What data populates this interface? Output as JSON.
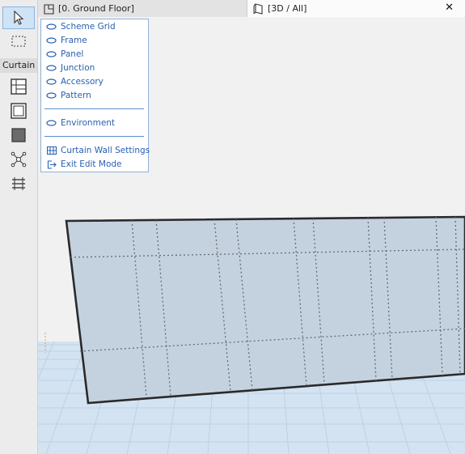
{
  "toolbox": {
    "section_label": "Curtain Wall",
    "tools": [
      {
        "icon": "arrow-pointer-icon"
      },
      {
        "icon": "marquee-icon"
      },
      {
        "icon": "curtain-wall-icon"
      },
      {
        "icon": "frame-icon"
      },
      {
        "icon": "panel-icon"
      },
      {
        "icon": "junction-icon"
      },
      {
        "icon": "accessory-icon"
      }
    ]
  },
  "tabs": [
    {
      "label": "[0. Ground Floor]",
      "icon": "floor-plan-icon"
    },
    {
      "label": "[3D / All]",
      "icon": "3d-view-icon"
    }
  ],
  "tab_close": "✕",
  "menu": {
    "visibility_items": [
      {
        "label": "Scheme Grid",
        "icon": "eye-icon"
      },
      {
        "label": "Frame",
        "icon": "eye-icon"
      },
      {
        "label": "Panel",
        "icon": "eye-icon"
      },
      {
        "label": "Junction",
        "icon": "eye-icon"
      },
      {
        "label": "Accessory",
        "icon": "eye-icon"
      },
      {
        "label": "Pattern",
        "icon": "eye-icon"
      }
    ],
    "environment": {
      "label": "Environment",
      "icon": "eye-icon"
    },
    "settings": {
      "label": "Curtain Wall Settings",
      "icon": "settings-grid-icon"
    },
    "exit": {
      "label": "Exit Edit Mode",
      "icon": "exit-icon"
    }
  },
  "colors": {
    "menu_text": "#2a5fb0",
    "active_tool": "#cfe3f7",
    "wall_fill": "#c4d2e0",
    "grid_floor": "#cfe0ef"
  }
}
